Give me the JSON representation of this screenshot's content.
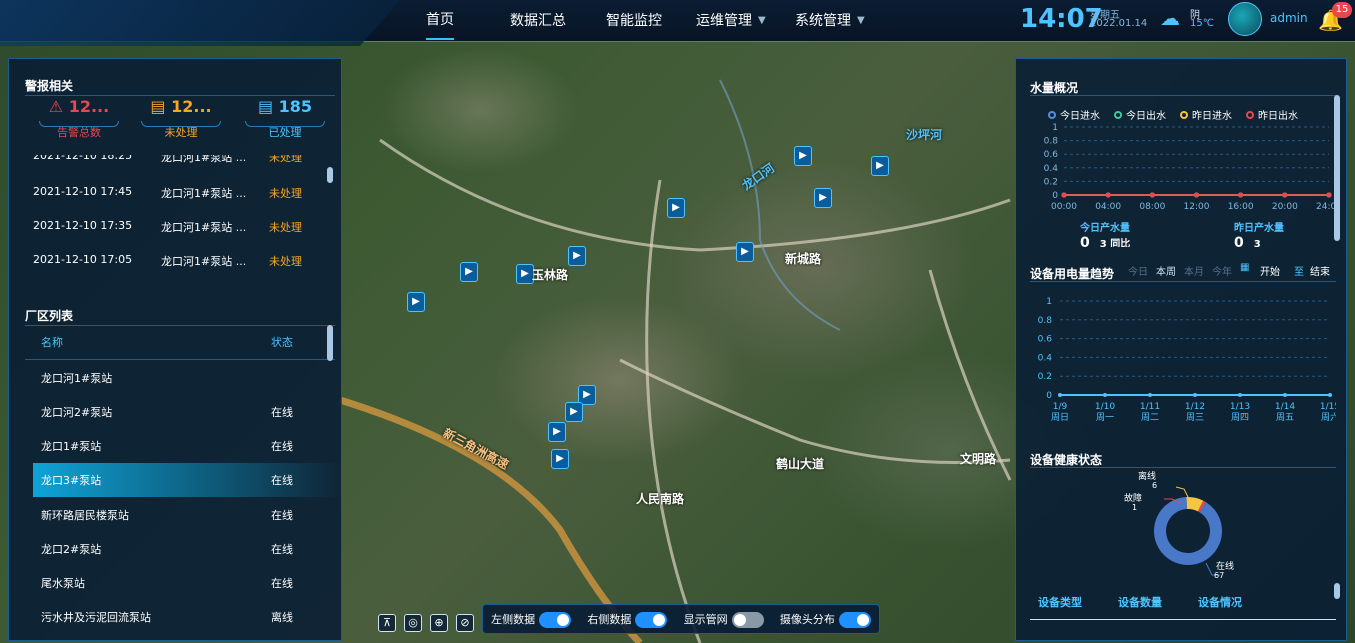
{
  "nav": {
    "items": [
      {
        "label": "首页"
      },
      {
        "label": "数据汇总"
      },
      {
        "label": "智能监控"
      },
      {
        "label": "运维管理"
      },
      {
        "label": "系统管理"
      }
    ]
  },
  "header": {
    "time": "14:07",
    "weekday": "星期五",
    "date": "2022.01.14",
    "weather": "阴",
    "temp": "15℃",
    "user": "admin",
    "notifications": "15"
  },
  "alarms": {
    "title": "警报相关",
    "total": "12...",
    "total_label": "告警总数",
    "unhandled": "12...",
    "unhandled_label": "未处理",
    "handled": "185",
    "handled_label": "已处理",
    "rows": [
      {
        "time": "2021-12-10 18:25",
        "site": "龙口河1#泵站 ...",
        "status": "未处理"
      },
      {
        "time": "2021-12-10 17:45",
        "site": "龙口河1#泵站 ...",
        "status": "未处理"
      },
      {
        "time": "2021-12-10 17:35",
        "site": "龙口河1#泵站 ...",
        "status": "未处理"
      },
      {
        "time": "2021-12-10 17:05",
        "site": "龙口河1#泵站 ...",
        "status": "未处理"
      }
    ]
  },
  "plants": {
    "title": "厂区列表",
    "col_name": "名称",
    "col_status": "状态",
    "rows": [
      {
        "name": "龙口河1#泵站",
        "status": ""
      },
      {
        "name": "龙口河2#泵站",
        "status": "在线"
      },
      {
        "name": "龙口1#泵站",
        "status": "在线"
      },
      {
        "name": "龙口3#泵站",
        "status": "在线"
      },
      {
        "name": "新环路居民楼泵站",
        "status": "在线"
      },
      {
        "name": "龙口2#泵站",
        "status": "在线"
      },
      {
        "name": "尾水泵站",
        "status": "在线"
      },
      {
        "name": "污水井及污泥回流泵站",
        "status": "离线"
      }
    ]
  },
  "water": {
    "title": "水量概况",
    "legend": [
      "今日进水",
      "今日出水",
      "昨日进水",
      "昨日出水"
    ],
    "today_label": "今日产水量",
    "today_value": "0",
    "today_cmp": "3 同比",
    "yest_label": "昨日产水量",
    "yest_value": "0",
    "yest_cmp": "3"
  },
  "power": {
    "title": "设备用电量趋势",
    "tabs": [
      "今日",
      "本周",
      "本月",
      "今年"
    ],
    "start": "开始",
    "to": "至",
    "end": "结束"
  },
  "health": {
    "title": "设备健康状态",
    "online_label": "在线",
    "online": "67",
    "offline_label": "离线",
    "offline": "6",
    "fault_label": "故障",
    "fault": "1",
    "tabs": [
      "设备类型",
      "设备数量",
      "设备情况"
    ]
  },
  "bottom": {
    "left_data": "左侧数据",
    "right_data": "右侧数据",
    "pipes": "显示管网",
    "cameras": "摄像头分布"
  },
  "map_labels": {
    "road1": "新城路",
    "road2": "玉林路",
    "road3": "鹤山大道",
    "road4": "人民南路",
    "road5": "文明路",
    "river1": "沙坪河",
    "river2": "龙口河",
    "road6": "新三角洲高速"
  },
  "chart_data": [
    {
      "type": "line",
      "title": "水量概况",
      "x": [
        "00:00",
        "04:00",
        "08:00",
        "12:00",
        "16:00",
        "20:00",
        "24:00"
      ],
      "ylim": [
        0,
        1
      ],
      "yticks": [
        "0",
        "0.2",
        "0.4",
        "0.6",
        "0.8",
        "1"
      ],
      "series": [
        {
          "name": "今日进水",
          "values": [
            0,
            0,
            0,
            0,
            0,
            0,
            0
          ]
        },
        {
          "name": "今日出水",
          "values": [
            0,
            0,
            0,
            0,
            0,
            0,
            0
          ]
        },
        {
          "name": "昨日进水",
          "values": [
            0,
            0,
            0,
            0,
            0,
            0,
            0
          ]
        },
        {
          "name": "昨日出水",
          "values": [
            0,
            0,
            0,
            0,
            0,
            0,
            0
          ]
        }
      ]
    },
    {
      "type": "line",
      "title": "设备用电量趋势",
      "x": [
        "1/9 周日",
        "1/10 周一",
        "1/11 周二",
        "1/12 周三",
        "1/13 周四",
        "1/14 周五",
        "1/15 周六"
      ],
      "ylim": [
        0,
        1
      ],
      "yticks": [
        "0",
        "0.2",
        "0.4",
        "0.6",
        "0.8",
        "1"
      ],
      "series": [
        {
          "values": [
            0,
            0,
            0,
            0,
            0,
            0,
            0
          ]
        }
      ]
    },
    {
      "type": "pie",
      "title": "设备健康状态",
      "categories": [
        "在线",
        "离线",
        "故障"
      ],
      "values": [
        67,
        6,
        1
      ]
    }
  ]
}
